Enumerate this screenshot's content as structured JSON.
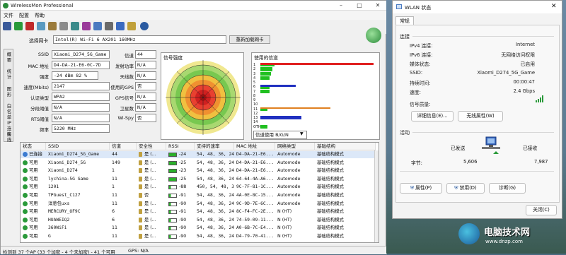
{
  "wirelessmon": {
    "title": "WirelessMon Professional",
    "menu": [
      "文件",
      "配置",
      "帮助"
    ],
    "adapter_label": "选择网卡",
    "adapter_value": "Intel(R) Wi-Fi 6 AX201 160MHz",
    "reload_label": "重新加载网卡",
    "side_tabs": [
      "概要",
      "统计",
      "图形",
      "白名单",
      "IP连接",
      "天线"
    ],
    "info_left": [
      {
        "label": "SSID",
        "value": "Xiaomi_D274_5G_Game"
      },
      {
        "label": "MAC 地址",
        "value": "D4-DA-21-E6-0C-7D"
      },
      {
        "label": "强度",
        "value": "-24 dBm    82 %"
      },
      {
        "label": "速度(Mbits)",
        "value": "2147"
      },
      {
        "label": "认证类型",
        "value": "WPA2"
      },
      {
        "label": "分段阈值",
        "value": "N/A"
      },
      {
        "label": "RTS阈值",
        "value": "N/A"
      },
      {
        "label": "频率",
        "value": "5220 MHz"
      }
    ],
    "info_right": [
      {
        "label": "信道",
        "value": "44"
      },
      {
        "label": "发射功率",
        "value": "N/A"
      },
      {
        "label": "天线数",
        "value": "N/A"
      },
      {
        "label": "使用的GPS",
        "value": "否"
      },
      {
        "label": "GPS信号",
        "value": "N/A"
      },
      {
        "label": "卫星数",
        "value": "N/A"
      },
      {
        "label": "Wi-Spy",
        "value": "否"
      }
    ],
    "signal_title": "信号强度",
    "channels_title": "使用的信道",
    "channel_select": "信道使用 B/G/N",
    "channel_rows": [
      {
        "label": "1",
        "bars": [
          {
            "color": "#e02020",
            "pct": 0.97
          },
          {
            "color": "#20c020",
            "pct": 0.12
          }
        ]
      },
      {
        "label": "2",
        "bars": [
          {
            "color": "#20c020",
            "pct": 0.1
          }
        ]
      },
      {
        "label": "3",
        "bars": [
          {
            "color": "#20c020",
            "pct": 0.09
          }
        ]
      },
      {
        "label": "4",
        "bars": [
          {
            "color": "#20c020",
            "pct": 0.08
          }
        ]
      },
      {
        "label": "5",
        "bars": []
      },
      {
        "label": "6",
        "bars": [
          {
            "color": "#2030c0",
            "pct": 0.3
          },
          {
            "color": "#20c020",
            "pct": 0.08
          }
        ]
      },
      {
        "label": "7",
        "bars": [
          {
            "color": "#20c020",
            "pct": 0.08
          }
        ]
      },
      {
        "label": "8",
        "bars": []
      },
      {
        "label": "9",
        "bars": []
      },
      {
        "label": "10",
        "bars": []
      },
      {
        "label": "11",
        "bars": [
          {
            "color": "#e08020",
            "pct": 0.6
          },
          {
            "color": "#20c020",
            "pct": 0.06
          }
        ]
      },
      {
        "label": "12",
        "bars": []
      },
      {
        "label": "13",
        "bars": [
          {
            "color": "#2030c0",
            "pct": 0.35
          }
        ]
      },
      {
        "label": "14",
        "bars": []
      },
      {
        "label": "OTH",
        "bars": [
          {
            "color": "#20c020",
            "pct": 0.06
          }
        ]
      }
    ],
    "columns": [
      "状态",
      "SSID",
      "信道",
      "安全性",
      "RSSI",
      "支持的速率",
      "MAC 地址",
      "网络类型",
      "基础结构"
    ],
    "networks": [
      {
        "status": "已连接",
        "ssid": "Xiaomi_D274_5G_Game",
        "ch": "44",
        "sec": "是 (...",
        "rssi": "-24",
        "rates": "54, 48, 36, 24...",
        "mac": "D4-DA-21-E6...",
        "type": "Automode",
        "infra": "基础结构模式",
        "sig": 4,
        "connected": true
      },
      {
        "status": "可用",
        "ssid": "Xiaomi_D274_5G",
        "ch": "149",
        "sec": "是 (...",
        "rssi": "-25",
        "rates": "54, 48, 36, 24...",
        "mac": "D4-DA-21-E6...",
        "type": "Automode",
        "infra": "基础结构模式",
        "sig": 4
      },
      {
        "status": "可用",
        "ssid": "Xiaomi_D274",
        "ch": "1",
        "sec": "是 (...",
        "rssi": "-23",
        "rates": "54, 48, 36, 24...",
        "mac": "D4-DA-21-E6...",
        "type": "Automode",
        "infra": "基础结构模式",
        "sig": 4
      },
      {
        "status": "可用",
        "ssid": "lychina-5G Game",
        "ch": "11",
        "sec": "是 (...",
        "rssi": "-25",
        "rates": "54, 48, 36, 24...",
        "mac": "64-64-4A-A6...",
        "type": "Automode",
        "infra": "基础结构模式",
        "sig": 4
      },
      {
        "status": "可用",
        "ssid": "1201",
        "ch": "1",
        "sec": "是 (...",
        "rssi": "-88",
        "rates": "450, 54, 48, 3...",
        "mac": "9C-7F-81-1C...",
        "type": "Automode",
        "infra": "基础结构模式",
        "sig": 1
      },
      {
        "status": "可用",
        "ssid": "TPGuest_C127",
        "ch": "11",
        "sec": "否",
        "rssi": "-91",
        "rates": "54, 48, 36, 24...",
        "mac": "4A-0E-8C-15...",
        "type": "Automode",
        "infra": "基础结构模式",
        "sig": 1
      },
      {
        "status": "可用",
        "ssid": "洋葱包uxs",
        "ch": "11",
        "sec": "是 (...",
        "rssi": "-90",
        "rates": "54, 48, 36, 24...",
        "mac": "9C-9D-7E-6C...",
        "type": "Automode",
        "infra": "基础结构模式",
        "sig": 1
      },
      {
        "status": "可用",
        "ssid": "MERCURY_OF9C",
        "ch": "6",
        "sec": "是 (...",
        "rssi": "-91",
        "rates": "54, 48, 36, 24...",
        "mac": "8C-F4-FC-2E...",
        "type": "N (HT)",
        "infra": "基础结构模式",
        "sig": 1
      },
      {
        "status": "可用",
        "ssid": "HUAWEIQ2",
        "ch": "6",
        "sec": "是 (...",
        "rssi": "-90",
        "rates": "54, 48, 36, 24...",
        "mac": "74-59-09-11...",
        "type": "N (HT)",
        "infra": "基础结构模式",
        "sig": 1
      },
      {
        "status": "可用",
        "ssid": "360WiFi",
        "ch": "11",
        "sec": "是 (...",
        "rssi": "-90",
        "rates": "54, 48, 36, 24...",
        "mac": "A0-6B-7C-E4...",
        "type": "N (HT)",
        "infra": "基础结构模式",
        "sig": 1
      },
      {
        "status": "可用",
        "ssid": "G",
        "ch": "11",
        "sec": "是 (...",
        "rssi": "-90",
        "rates": "54, 48, 36, 24...",
        "mac": "D4-79-70-41...",
        "type": "N (HT)",
        "infra": "基础结构模式",
        "sig": 1
      }
    ],
    "status_left": "检测到 37 个AP (33 个加密 - 4 个未加密) - 41 个可用",
    "status_right": "GPS: N/A"
  },
  "wlan": {
    "title": "WLAN 状态",
    "tab": "常规",
    "connection_header": "连接",
    "rows": [
      {
        "label": "IPv4 连接:",
        "value": "Internet"
      },
      {
        "label": "IPv6 连接:",
        "value": "无网络访问权限"
      },
      {
        "label": "媒体状态:",
        "value": "已启用"
      },
      {
        "label": "SSID:",
        "value": "Xiaomi_D274_5G_Game"
      },
      {
        "label": "持续时间:",
        "value": "00:00:47"
      },
      {
        "label": "速度:",
        "value": "2.4 Gbps"
      }
    ],
    "signal_quality": "信号质量:",
    "details_btn": "详细信息(E)...",
    "wireless_props_btn": "无线属性(W)",
    "activity_header": "活动",
    "sent": "已发送",
    "received": "已接收",
    "bytes_label": "字节:",
    "sent_val": "5,606",
    "recv_val": "7,987",
    "props_btn": "属性(P)",
    "disable_btn": "禁用(D)",
    "diagnose_btn": "诊断(G)",
    "close_btn": "关闭(C)"
  },
  "watermark": {
    "text": "电脑技术网",
    "url": "www.dnzp.com"
  }
}
